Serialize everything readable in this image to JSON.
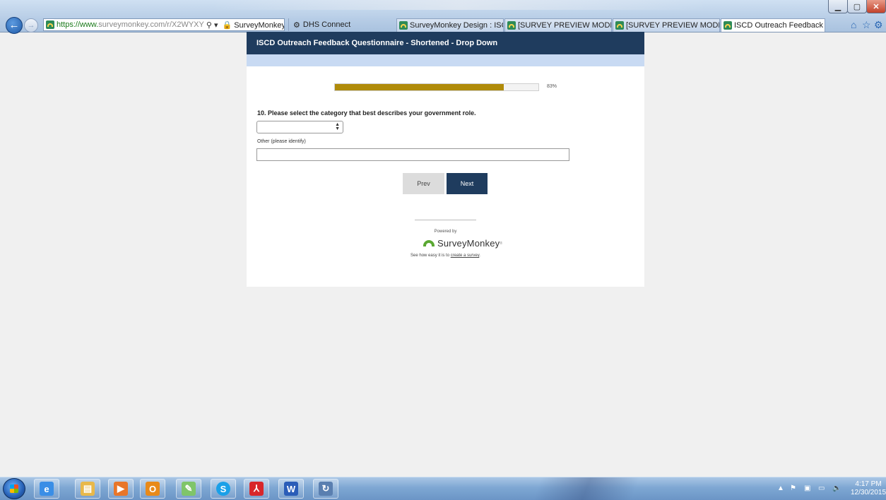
{
  "browser": {
    "url_prefix": "https://www.",
    "url_rest": "surveymonkey.com/r/X2WYXY",
    "search_glyph": "⚲ ▾",
    "lock_glyph": "🔒",
    "site_label": "SurveyMonkey In... ↻",
    "dhs_tab": "DHS Connect",
    "tabs": [
      {
        "label": "SurveyMonkey Design : ISCD ..."
      },
      {
        "label": "[SURVEY PREVIEW MODE] ISC..."
      },
      {
        "label": "[SURVEY PREVIEW MODE] ISC..."
      },
      {
        "label": "ISCD Outreach Feedback ..."
      }
    ],
    "tab_close": "×",
    "home_glyph": "⌂",
    "star_glyph": "☆",
    "gear_glyph": "⚙",
    "min_glyph": "▁",
    "max_glyph": "▢",
    "close_glyph": "✕",
    "back_glyph": "←",
    "fwd_glyph": "→"
  },
  "survey": {
    "header_title": "ISCD Outreach Feedback Questionnaire - Shortened - Drop Down",
    "progress_percent": 83,
    "progress_text": "83%",
    "question": "10. Please select the category that best describes your government role.",
    "select_value": "",
    "select_arrows": "▲\n▼",
    "other_label": "Other (please identify)",
    "other_value": "",
    "prev_label": "Prev",
    "next_label": "Next",
    "powered_by": "Powered by",
    "brand_name": "SurveyMonkey",
    "brand_tm": "®",
    "create_prefix": "See how easy it is to ",
    "create_link": "create a survey",
    "create_suffix": "."
  },
  "taskbar": {
    "apps": [
      {
        "name": "ie",
        "glyph": "e",
        "color": "#3a8ee6"
      },
      {
        "name": "explorer",
        "glyph": "▤",
        "color": "#e8b84a"
      },
      {
        "name": "media",
        "glyph": "▶",
        "color": "#e8762a"
      },
      {
        "name": "outlook",
        "glyph": "O",
        "color": "#e88a1a"
      },
      {
        "name": "notes",
        "glyph": "✎",
        "color": "#7fc56a"
      },
      {
        "name": "skype",
        "glyph": "S",
        "color": "#1aa0e8"
      },
      {
        "name": "acrobat",
        "glyph": "⅄",
        "color": "#d8262a"
      },
      {
        "name": "word",
        "glyph": "W",
        "color": "#2b5db8"
      },
      {
        "name": "notepad",
        "glyph": "↻",
        "color": "#5a7fb0"
      }
    ],
    "time": "4:17 PM",
    "date": "12/30/2015",
    "tray_glyphs": [
      "▲",
      "⚑",
      "▣",
      "▭",
      "🔈"
    ]
  }
}
